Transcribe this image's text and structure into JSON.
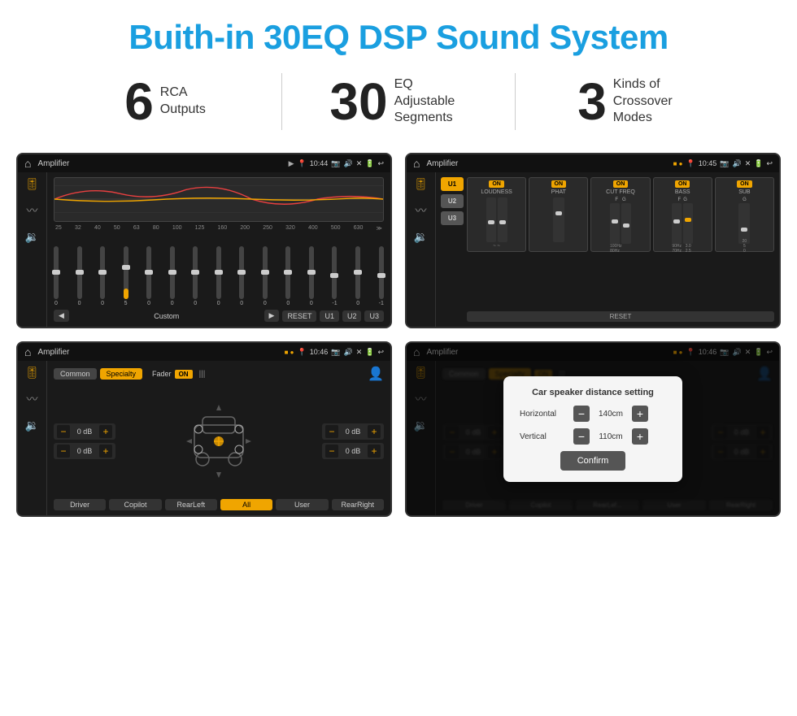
{
  "header": {
    "title": "Buith-in 30EQ DSP Sound System"
  },
  "stats": [
    {
      "number": "6",
      "text_line1": "RCA",
      "text_line2": "Outputs"
    },
    {
      "number": "30",
      "text_line1": "EQ Adjustable",
      "text_line2": "Segments"
    },
    {
      "number": "3",
      "text_line1": "Kinds of",
      "text_line2": "Crossover Modes"
    }
  ],
  "screens": [
    {
      "id": "screen1",
      "app_name": "Amplifier",
      "time": "10:44",
      "type": "eq_30band"
    },
    {
      "id": "screen2",
      "app_name": "Amplifier",
      "time": "10:45",
      "type": "eq_bands"
    },
    {
      "id": "screen3",
      "app_name": "Amplifier",
      "time": "10:46",
      "type": "fader"
    },
    {
      "id": "screen4",
      "app_name": "Amplifier",
      "time": "10:46",
      "type": "distance_dialog"
    }
  ],
  "screen1": {
    "eq_labels": [
      "25",
      "32",
      "40",
      "50",
      "63",
      "80",
      "100",
      "125",
      "160",
      "200",
      "250",
      "320",
      "400",
      "500",
      "630"
    ],
    "eq_values": [
      "0",
      "0",
      "0",
      "5",
      "0",
      "0",
      "0",
      "0",
      "0",
      "0",
      "0",
      "0",
      "-1",
      "0",
      "-1"
    ],
    "custom_label": "Custom",
    "reset_label": "RESET",
    "u1": "U1",
    "u2": "U2",
    "u3": "U3"
  },
  "screen2": {
    "presets": [
      "U1",
      "U2",
      "U3"
    ],
    "bands": [
      "LOUDNESS",
      "PHAT",
      "CUT FREQ",
      "BASS",
      "SUB"
    ],
    "reset_label": "RESET"
  },
  "screen3": {
    "tab_common": "Common",
    "tab_specialty": "Specialty",
    "fader_label": "Fader",
    "on_label": "ON",
    "db_values": [
      "0 dB",
      "0 dB",
      "0 dB",
      "0 dB"
    ],
    "driver_label": "Driver",
    "copilot_label": "Copilot",
    "rear_left_label": "RearLeft",
    "all_label": "All",
    "user_label": "User",
    "rear_right_label": "RearRight"
  },
  "screen4": {
    "tab_common": "Common",
    "tab_specialty": "Specialty",
    "dialog_title": "Car speaker distance setting",
    "horizontal_label": "Horizontal",
    "horizontal_value": "140cm",
    "vertical_label": "Vertical",
    "vertical_value": "110cm",
    "confirm_label": "Confirm",
    "driver_label": "Driver",
    "copilot_label": "Copilot",
    "rear_left_label": "RearLef...",
    "user_label": "User",
    "rear_right_label": "RearRight",
    "db1": "0 dB",
    "db2": "0 dB"
  }
}
